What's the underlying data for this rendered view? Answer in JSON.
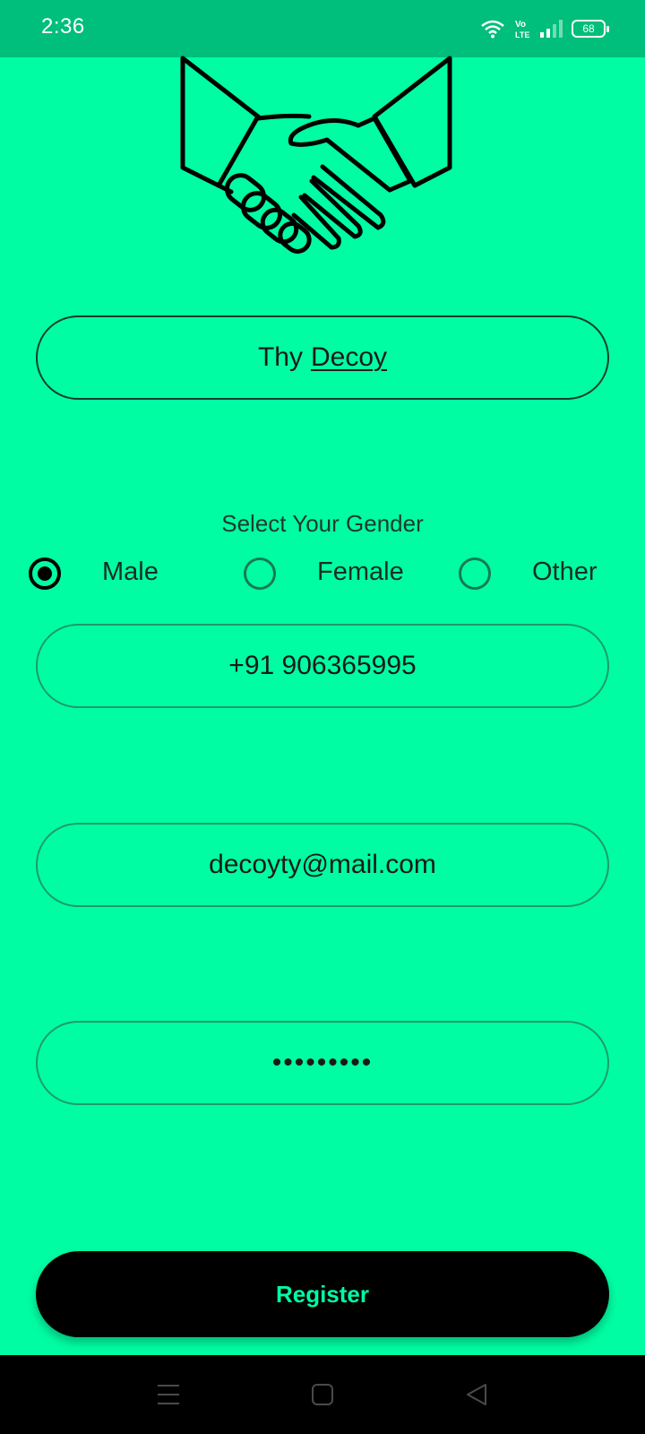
{
  "status_bar": {
    "time": "2:36",
    "network_label": "Vo LTE",
    "battery": "68",
    "icons": [
      "wifi-icon",
      "volte-icon",
      "signal-icon",
      "battery-icon"
    ]
  },
  "logo": {
    "icon": "handshake-icon"
  },
  "form": {
    "name_first": "Thy",
    "name_second": "Decoy",
    "gender_title": "Select Your Gender",
    "gender_options": [
      {
        "label": "Male",
        "selected": true
      },
      {
        "label": "Female",
        "selected": false
      },
      {
        "label": "Other",
        "selected": false
      }
    ],
    "phone": "+91 906365995",
    "email": "decoyty@mail.com",
    "password_masked": "•••••••••",
    "register_label": "Register"
  },
  "nav_bar": {
    "icons": [
      "menu-icon",
      "home-icon",
      "back-icon"
    ]
  },
  "colors": {
    "background": "#00FDA3",
    "status_bar": "#00BE7B",
    "button": "#000000",
    "button_text": "#00FDA3"
  }
}
